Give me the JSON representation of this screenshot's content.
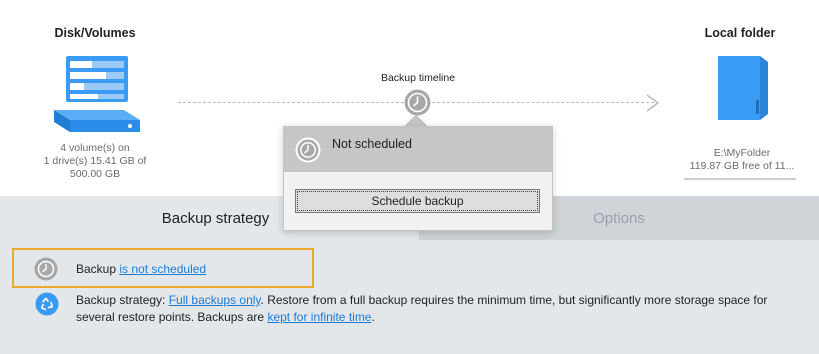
{
  "source": {
    "title": "Disk/Volumes",
    "description_line1": "4 volume(s) on",
    "description_line2": "1 drive(s) 15.41 GB of",
    "description_line3": "500.00 GB"
  },
  "destination": {
    "title": "Local folder",
    "path": "E:\\MyFolder",
    "free_space": "119.87 GB free of 11..."
  },
  "timeline": {
    "label": "Backup timeline"
  },
  "schedule_popup": {
    "status": "Not scheduled",
    "button_label": "Schedule backup"
  },
  "tabs": [
    {
      "label": "Backup strategy",
      "active": true
    },
    {
      "label": "Options",
      "active": false
    }
  ],
  "content": {
    "schedule_prefix": "Backup ",
    "schedule_link": "is not scheduled",
    "strategy_prefix": "Backup strategy: ",
    "strategy_link": "Full backups only",
    "strategy_middle": ". Restore from a full backup requires the minimum time, but significantly more storage space for several restore points. Backups are ",
    "retention_link": "kept for infinite time",
    "strategy_suffix": "."
  },
  "colors": {
    "accent_blue": "#3a9bf4",
    "link": "#1a7ad8",
    "highlight": "#f0a930",
    "panel_background": "#e3e7ea"
  },
  "icons": {
    "source": "disk-volumes-icon",
    "destination": "local-folder-icon",
    "timeline": "clock-icon",
    "schedule": "clock-icon",
    "strategy": "recycle-icon"
  }
}
